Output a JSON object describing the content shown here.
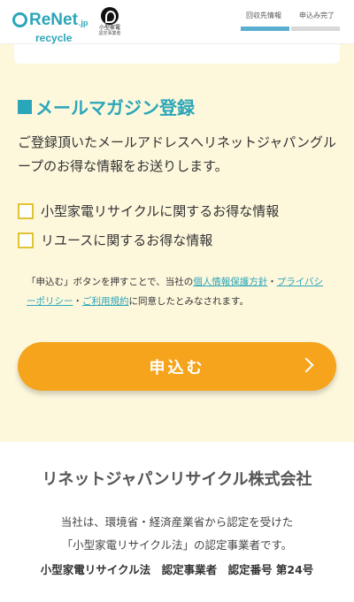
{
  "header": {
    "logo_text": "ReNet",
    "logo_jp": ".jp",
    "logo_sub": "recycle",
    "mark_line1": "小型家電",
    "mark_line2": "認定事業者",
    "steps": [
      {
        "label": "回収先情報",
        "state": "active"
      },
      {
        "label": "申込み完了",
        "state": "inactive"
      }
    ]
  },
  "newsletter": {
    "title": "メールマガジン登録",
    "description": "ご登録頂いたメールアドレスへリネットジャパングループのお得な情報をお送りします。",
    "options": [
      {
        "label": "小型家電リサイクルに関するお得な情報",
        "checked": false
      },
      {
        "label": "リユースに関するお得な情報",
        "checked": false
      }
    ]
  },
  "note": {
    "prefix": "「申込む」ボタンを押すことで、当社の",
    "link_privacy": "個人情報保護方針",
    "sep1": "・",
    "link_privacy_policy": "プライバシーポリシー",
    "sep2": "・",
    "link_terms": "ご利用規約",
    "suffix": "に同意したとみなされます。"
  },
  "submit": {
    "label": "申込む"
  },
  "footer": {
    "company": "リネットジャパンリサイクル株式会社",
    "cert_line1": "当社は、環境省・経済産業省から認定を受けた",
    "cert_line2": "「小型家電リサイクル法」の認定事業者です。",
    "cert_line3": "小型家電リサイクル法　認定事業者　認定番号 第24号"
  },
  "colors": {
    "accent": "#2aa6b9",
    "button": "#f5a41c",
    "background": "#fdf7dc",
    "checkbox_border": "#e0c436"
  }
}
